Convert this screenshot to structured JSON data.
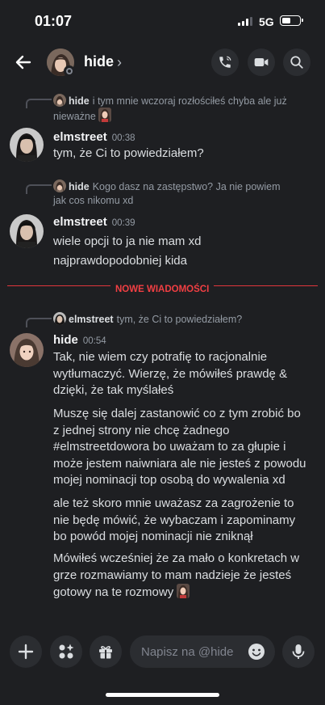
{
  "status": {
    "time": "01:07",
    "network": "5G"
  },
  "header": {
    "name": "hide"
  },
  "messages": {
    "m1": {
      "reply_name": "hide",
      "reply_text_1": "i tym mnie wczoraj rozłościłeś chyba ale już",
      "reply_text_2": "nieważne",
      "author": "elmstreet",
      "time": "00:38",
      "lines": [
        "tym, że Ci to powiedziałem?"
      ]
    },
    "m2": {
      "reply_name": "hide",
      "reply_text_1": "Kogo dasz na zastępstwo? Ja nie powiem",
      "reply_text_2": "jak cos nikomu xd",
      "author": "elmstreet",
      "time": "00:39",
      "lines": [
        "wiele opcji to ja nie mam xd",
        "najprawdopodobniej kida"
      ]
    },
    "divider": "NOWE WIADOMOŚCI",
    "m3": {
      "reply_name": "elmstreet",
      "reply_text_1": "tym, że Ci to powiedziałem?",
      "author": "hide",
      "time": "00:54",
      "p1": [
        "Tak, nie wiem czy potrafię to racjonalnie",
        "wytłumaczyć. Wierzę, że mówiłeś prawdę &",
        "dzięki, że tak myślałeś"
      ],
      "p2": [
        "Muszę się dalej zastanowić co z tym zrobić bo",
        "z jednej strony nie chcę żadnego",
        "#elmstreetdowora bo uważam to za głupie i",
        "może jestem naiwniara ale nie jesteś z powodu",
        "mojej nominacji top osobą do wywalenia xd"
      ],
      "p3": [
        "ale też skoro mnie uważasz za zagrożenie to",
        "nie będę mówić, że wybaczam i zapominamy",
        "bo powód mojej nominacji nie zniknął"
      ],
      "p4": [
        "Mówiłeś wcześniej że za mało o konkretach w",
        "grze rozmawiamy to mam nadzieje że jesteś",
        "gotowy na te rozmowy"
      ]
    }
  },
  "composer": {
    "placeholder": "Napisz na @hide"
  }
}
